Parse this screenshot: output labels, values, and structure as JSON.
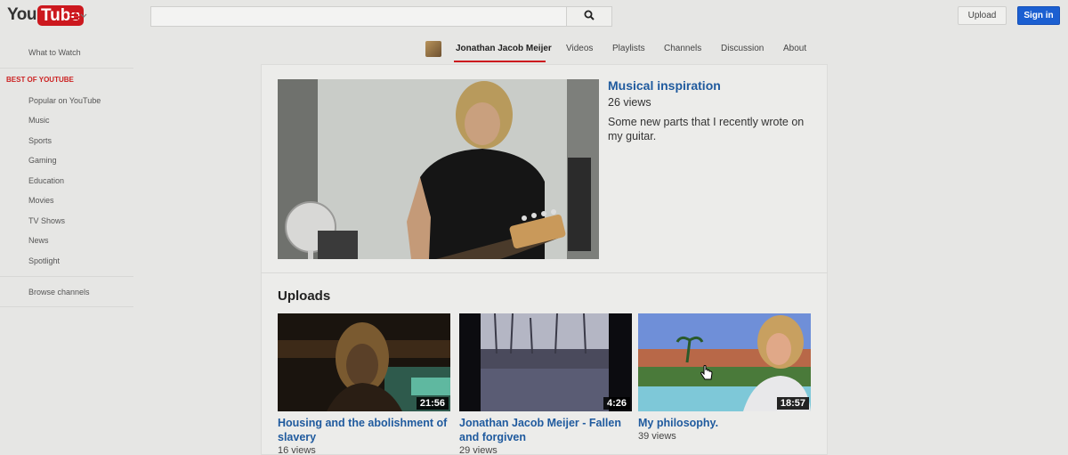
{
  "header": {
    "logo_you": "You",
    "logo_tube": "Tube",
    "search_placeholder": "",
    "upload_label": "Upload",
    "signin_label": "Sign in",
    "brand_color": "#cc181e",
    "signin_color": "#1b5fd1"
  },
  "sidebar": {
    "what_to_watch": "What to Watch",
    "best_heading": "BEST OF YOUTUBE",
    "items": [
      "Popular on YouTube",
      "Music",
      "Sports",
      "Gaming",
      "Education",
      "Movies",
      "TV Shows",
      "News",
      "Spotlight"
    ],
    "browse_channels": "Browse channels"
  },
  "channel": {
    "name": "Jonathan Jacob Meijer",
    "tabs": [
      "Videos",
      "Playlists",
      "Channels",
      "Discussion",
      "About"
    ]
  },
  "featured": {
    "title": "Musical inspiration",
    "views": "26 views",
    "description": "Some new parts that I recently wrote on my guitar."
  },
  "uploads": {
    "heading": "Uploads",
    "videos": [
      {
        "title": "Housing and the abolishment of slavery",
        "views": "16 views",
        "duration": "21:56"
      },
      {
        "title": "Jonathan Jacob Meijer - Fallen and forgiven",
        "views": "29 views",
        "duration": "4:26"
      },
      {
        "title": "My philosophy.",
        "views": "39 views",
        "duration": "18:57"
      }
    ]
  },
  "icons": {
    "menu": "menu-icon",
    "search": "search-icon",
    "cursor": "hand-cursor-icon"
  }
}
